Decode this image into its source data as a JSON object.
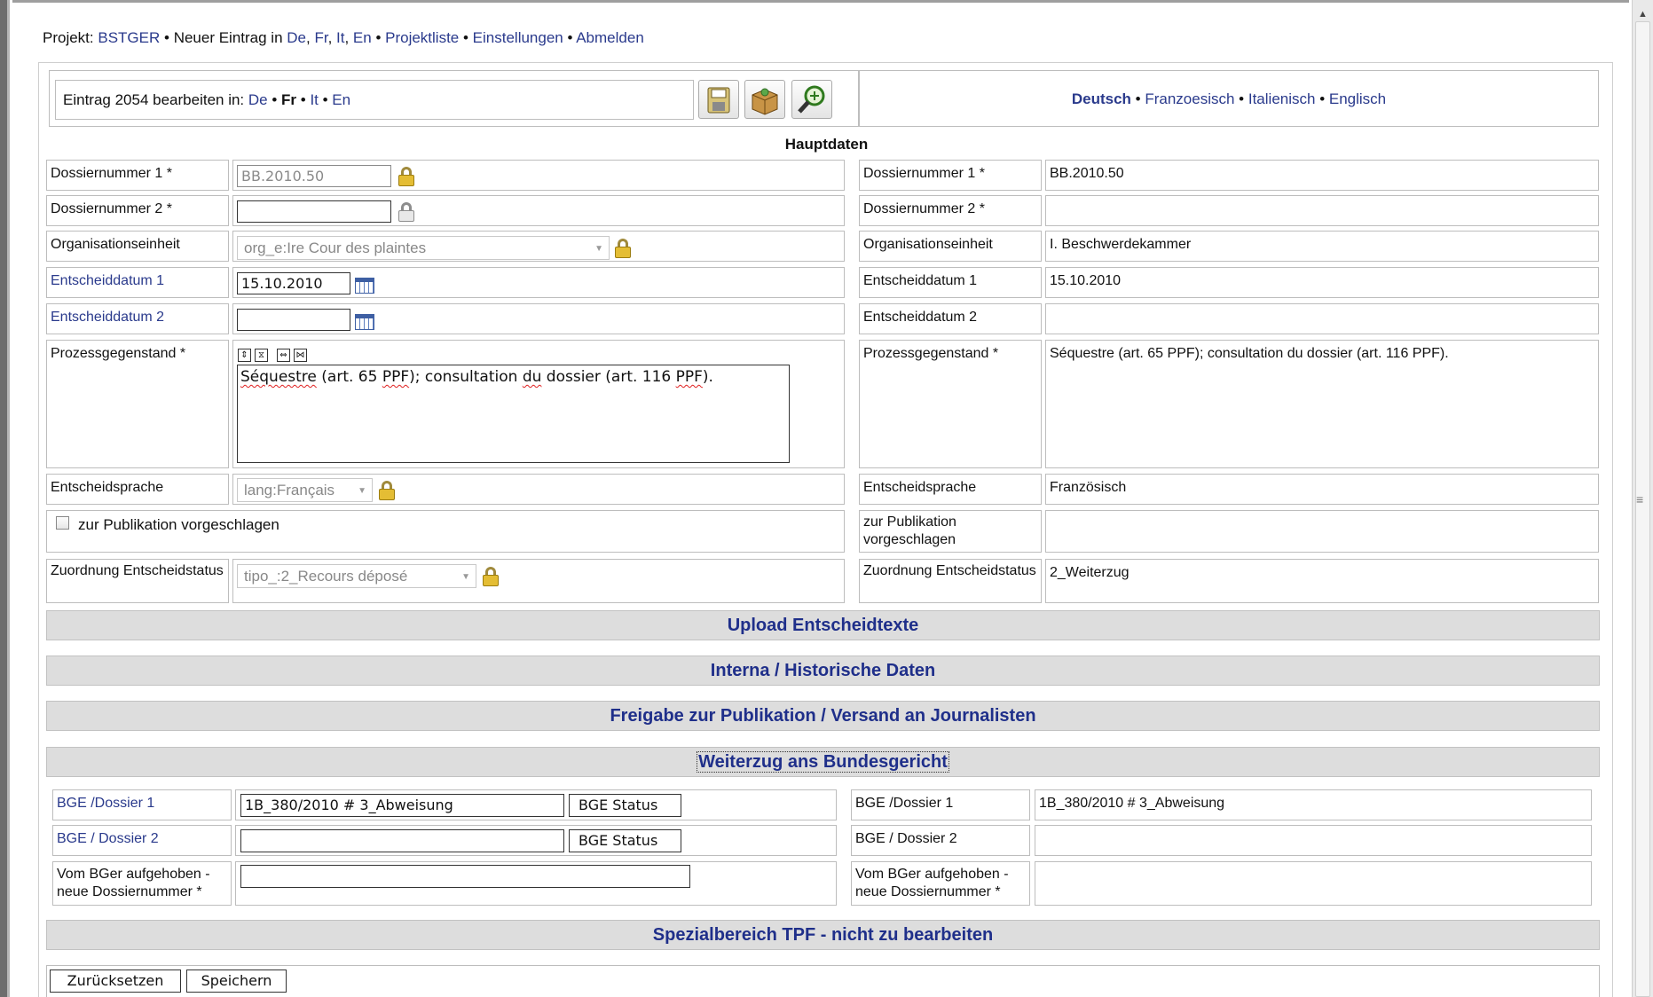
{
  "topbar": {
    "projekt_label": "Projekt:",
    "projekt_name": "BSTGER",
    "neuer_eintrag": "Neuer Eintrag in",
    "langs": [
      "De",
      "Fr",
      "It",
      "En"
    ],
    "projektliste": "Projektliste",
    "einstellungen": "Einstellungen",
    "abmelden": "Abmelden"
  },
  "edit_header": {
    "text": "Eintrag 2054 bearbeiten in:",
    "langs": [
      "De",
      "Fr",
      "It",
      "En"
    ],
    "active_lang": "Fr"
  },
  "lang_header": [
    "Deutsch",
    "Franzoesisch",
    "Italienisch",
    "Englisch"
  ],
  "hauptdaten_title": "Hauptdaten",
  "fields": {
    "dossier1": {
      "label": "Dossiernummer 1 *",
      "value": "BB.2010.50",
      "right": "BB.2010.50"
    },
    "dossier2": {
      "label": "Dossiernummer 2 *",
      "value": "",
      "right": ""
    },
    "org": {
      "label": "Organisationseinheit",
      "value": "org_e:Ire Cour des plaintes",
      "right": "I. Beschwerdekammer"
    },
    "datum1": {
      "label": "Entscheiddatum 1",
      "value": "15.10.2010",
      "right": "15.10.2010"
    },
    "datum2": {
      "label": "Entscheiddatum 2",
      "value": "",
      "right": ""
    },
    "prozess": {
      "label": "Prozessgegenstand *",
      "value_parts": [
        "Séquestre",
        " (art. 65 ",
        "PPF",
        "); consultation ",
        "du",
        " dossier (art. 116 ",
        "PPF",
        ")."
      ],
      "right": "Séquestre (art. 65 PPF); consultation du dossier (art. 116 PPF)."
    },
    "sprache": {
      "label": "Entscheidsprache",
      "value": "lang:Français",
      "right": "Französisch"
    },
    "publikation": {
      "label": "zur Publikation vorgeschlagen",
      "right_label": "zur Publikation vorgeschlagen",
      "right": ""
    },
    "status": {
      "label": "Zuordnung Entscheidstatus",
      "value": "tipo_:2_Recours déposé",
      "right": "2_Weiterzug"
    }
  },
  "sections": {
    "upload": "Upload Entscheidtexte",
    "interna": "Interna / Historische Daten",
    "freigabe": "Freigabe zur Publikation / Versand an Journalisten",
    "weiterzug": "Weiterzug ans Bundesgericht",
    "spezial": "Spezialbereich TPF - nicht zu bearbeiten"
  },
  "bge": {
    "d1": {
      "label": "BGE /Dossier 1",
      "value": "1B_380/2010 # 3_Abweisung",
      "right": "1B_380/2010 # 3_Abweisung"
    },
    "d2": {
      "label": "BGE / Dossier 2",
      "value": "",
      "right": ""
    },
    "status_button": "BGE Status",
    "aufgehoben": {
      "label": "Vom BGer aufgehoben - neue Dossiernummer *",
      "value": "",
      "right": ""
    }
  },
  "buttons": {
    "reset": "Zurücksetzen",
    "save": "Speichern"
  }
}
